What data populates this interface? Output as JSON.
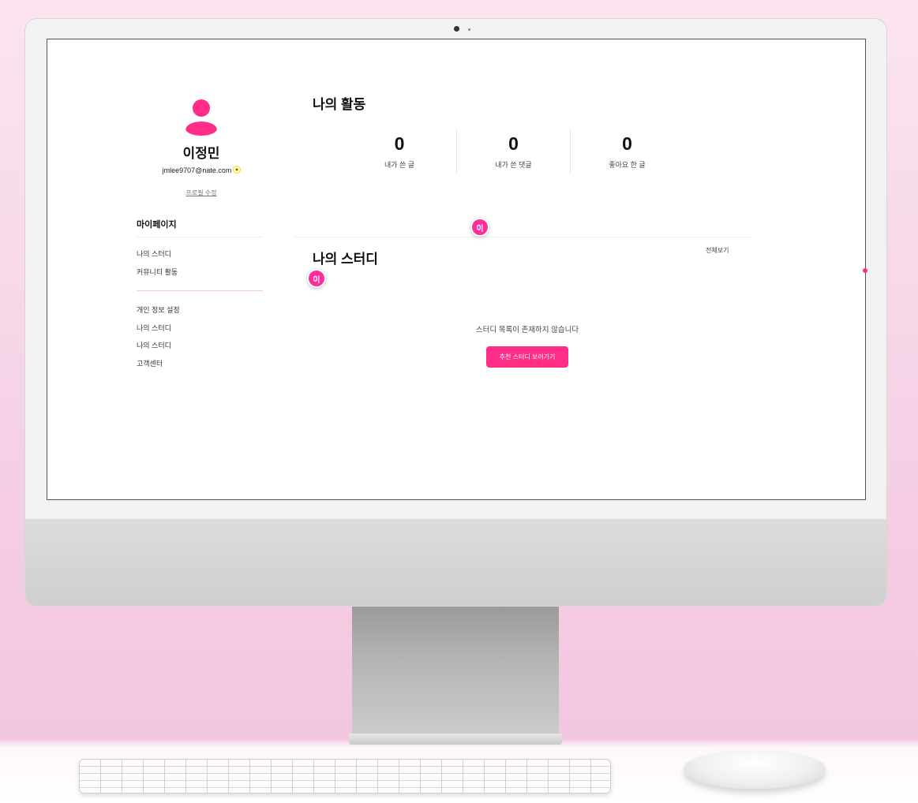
{
  "profile": {
    "name": "이정민",
    "email": "jmlee9707@nate.com",
    "edit_label": "프로필 수정"
  },
  "sidebar": {
    "title": "마이페이지",
    "group1": [
      "나의 스터디",
      "커뮤니티 활동"
    ],
    "group2": [
      "개인 정보 설정",
      "나의 스터디",
      "나의 스터디",
      "고객센터"
    ]
  },
  "activity": {
    "title": "나의 활동",
    "stats": [
      {
        "value": "0",
        "label": "내가 쓴 글"
      },
      {
        "value": "0",
        "label": "내가 쓴 댓글"
      },
      {
        "value": "0",
        "label": "좋아요 한 글"
      }
    ]
  },
  "study": {
    "title": "나의 스터디",
    "view_all": "전체보기",
    "empty_message": "스터디 목록이 존재하지 않습니다",
    "cta_label": "추천 스터디 보러가기"
  },
  "cursors": [
    "이",
    "이"
  ],
  "colors": {
    "accent": "#ff2d86",
    "badge": "#ffd400"
  }
}
